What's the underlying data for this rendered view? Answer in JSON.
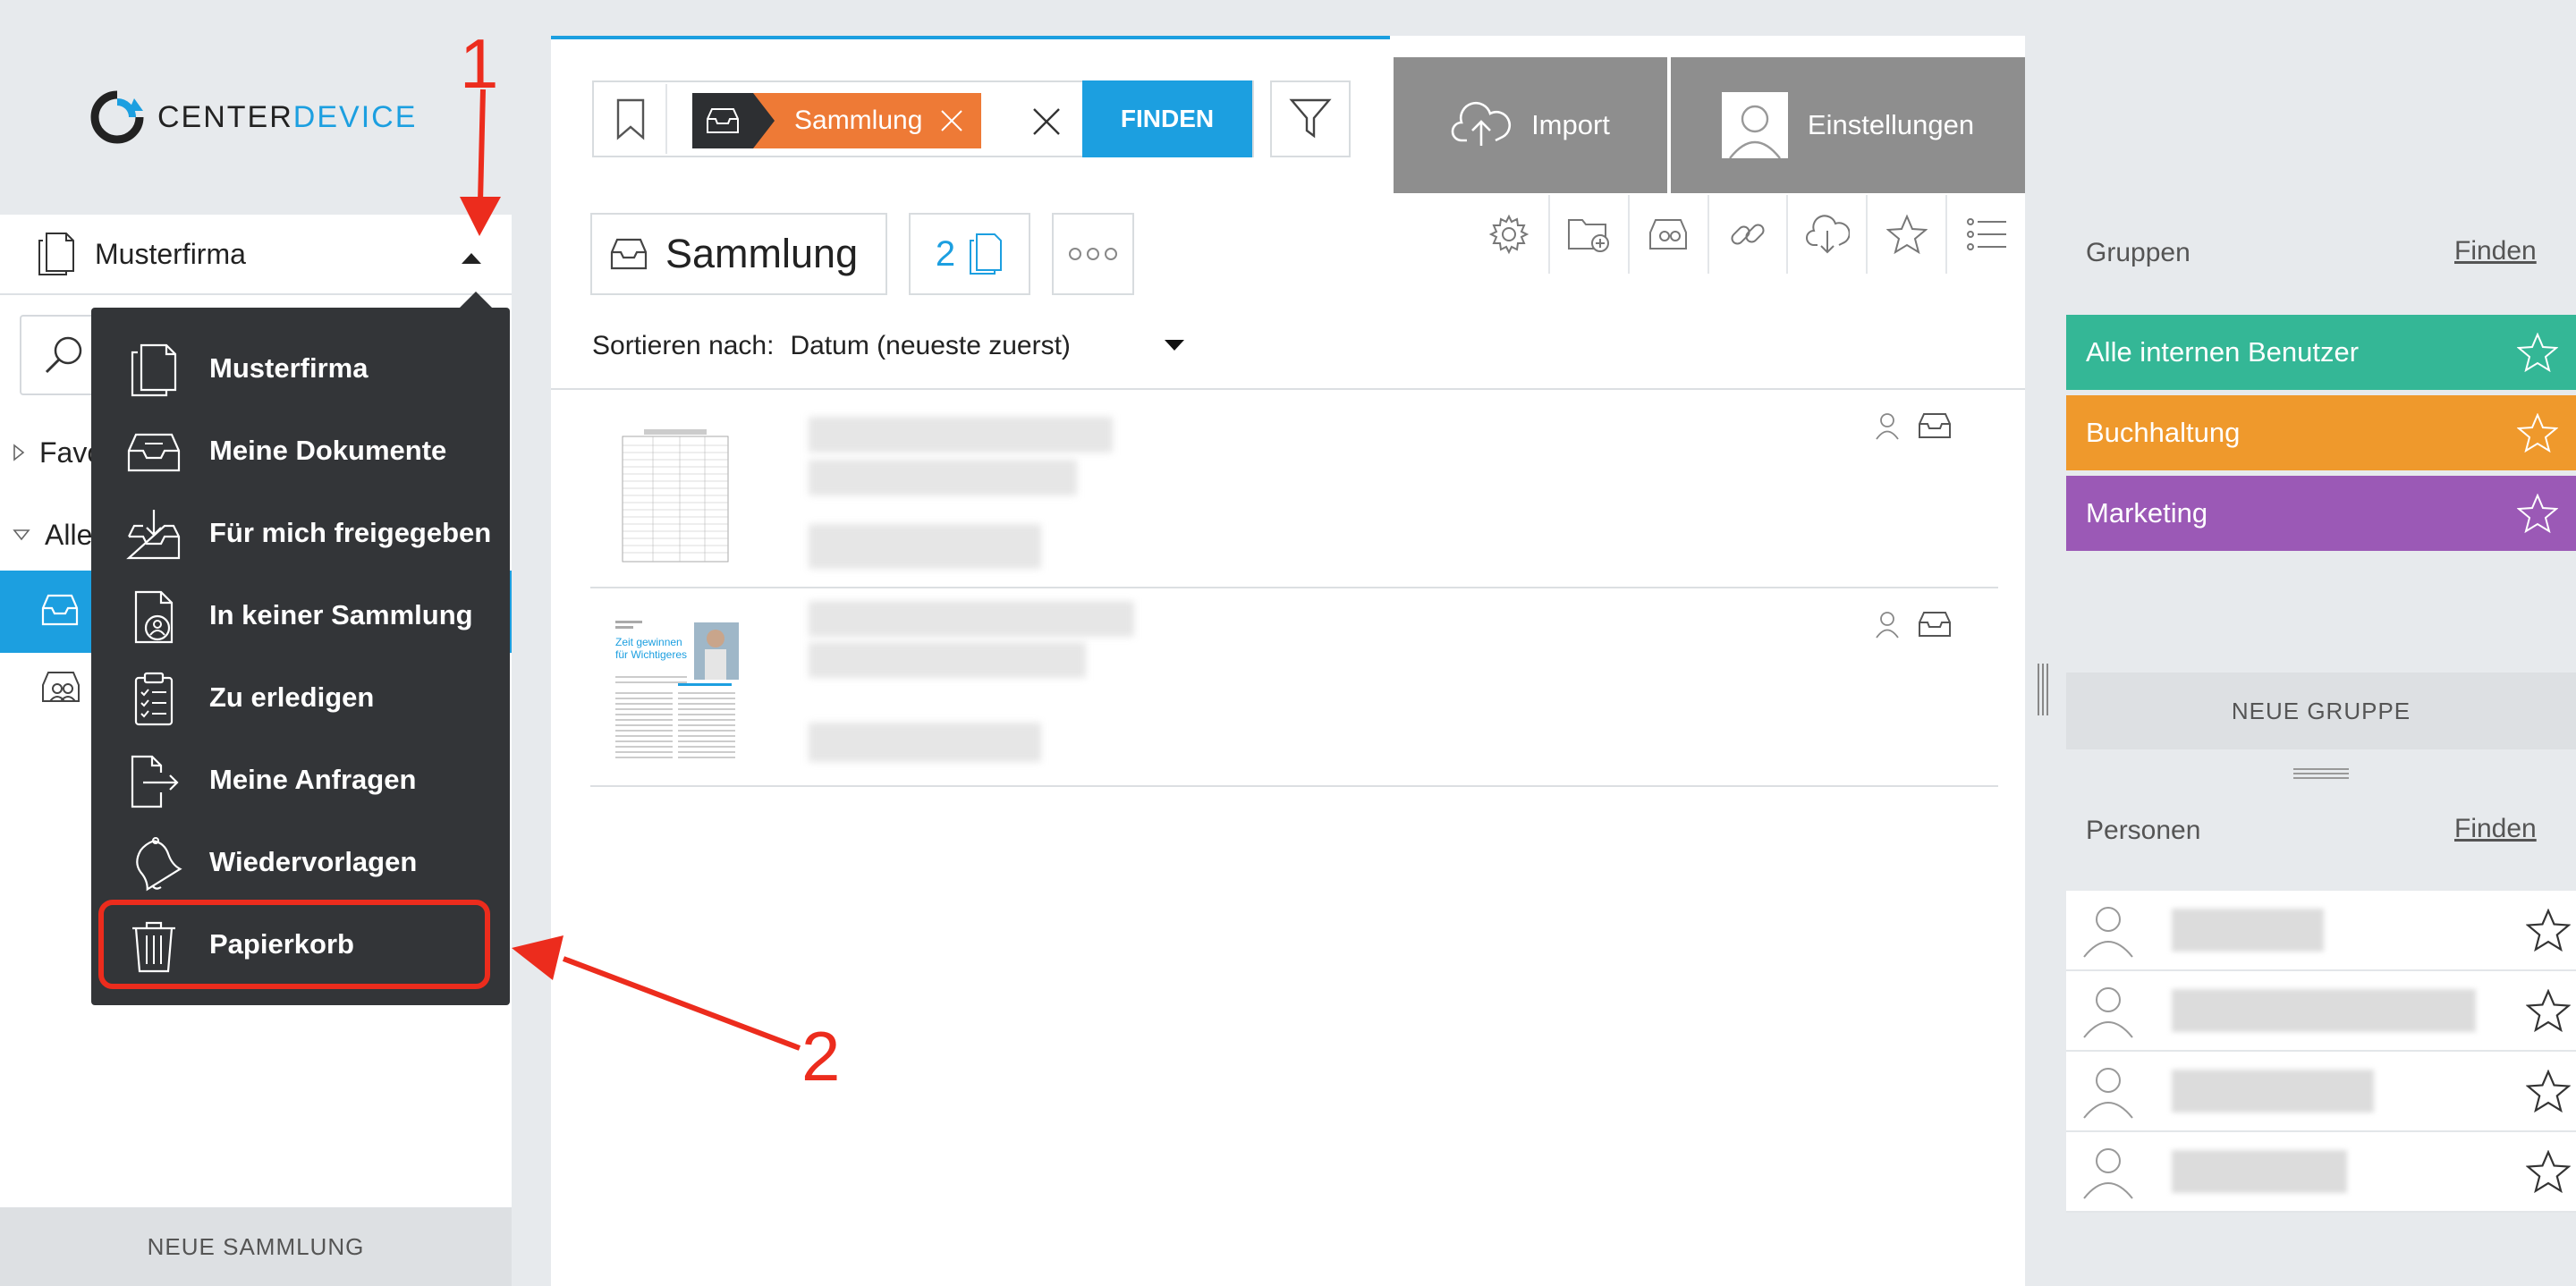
{
  "app": {
    "logo_text_part1": "CENTER",
    "logo_text_part2": "DEVICE"
  },
  "sidebar": {
    "workspace": "Musterfirma",
    "tree": [
      {
        "label": "Favo"
      },
      {
        "label": "Alle"
      }
    ],
    "new_collection": "NEUE SAMMLUNG"
  },
  "dropdown": {
    "items": [
      {
        "label": "Musterfirma",
        "icon": "documents-icon"
      },
      {
        "label": "Meine Dokumente",
        "icon": "inbox-tray-icon"
      },
      {
        "label": "Für mich freigegeben",
        "icon": "shared-download-icon"
      },
      {
        "label": "In keiner Sammlung",
        "icon": "document-user-icon"
      },
      {
        "label": "Zu erledigen",
        "icon": "clipboard-checklist-icon"
      },
      {
        "label": "Meine Anfragen",
        "icon": "document-arrow-icon"
      },
      {
        "label": "Wiedervorlagen",
        "icon": "bell-icon"
      },
      {
        "label": "Papierkorb",
        "icon": "trash-icon"
      }
    ]
  },
  "search": {
    "tag_label": "Sammlung",
    "find_label": "FINDEN"
  },
  "header": {
    "import_label": "Import",
    "settings_label": "Einstellungen"
  },
  "collection": {
    "title": "Sammlung",
    "count": "2"
  },
  "sort": {
    "label": "Sortieren nach:",
    "value": "Datum (neueste zuerst)"
  },
  "thumbnails": {
    "doc2_headline1": "Zeit gewinnen",
    "doc2_headline2": "für Wichtigeres"
  },
  "groups": {
    "title": "Gruppen",
    "find_label": "Finden",
    "items": [
      {
        "name": "Alle internen Benutzer",
        "color": "#34b796"
      },
      {
        "name": "Buchhaltung",
        "color": "#ef992c"
      },
      {
        "name": "Marketing",
        "color": "#9b59b6"
      }
    ],
    "new_group": "NEUE GRUPPE"
  },
  "persons": {
    "title": "Personen",
    "find_label": "Finden",
    "count_rows": 4
  },
  "annotations": {
    "step1": "1",
    "step2": "2",
    "color": "#ec2c1d"
  }
}
